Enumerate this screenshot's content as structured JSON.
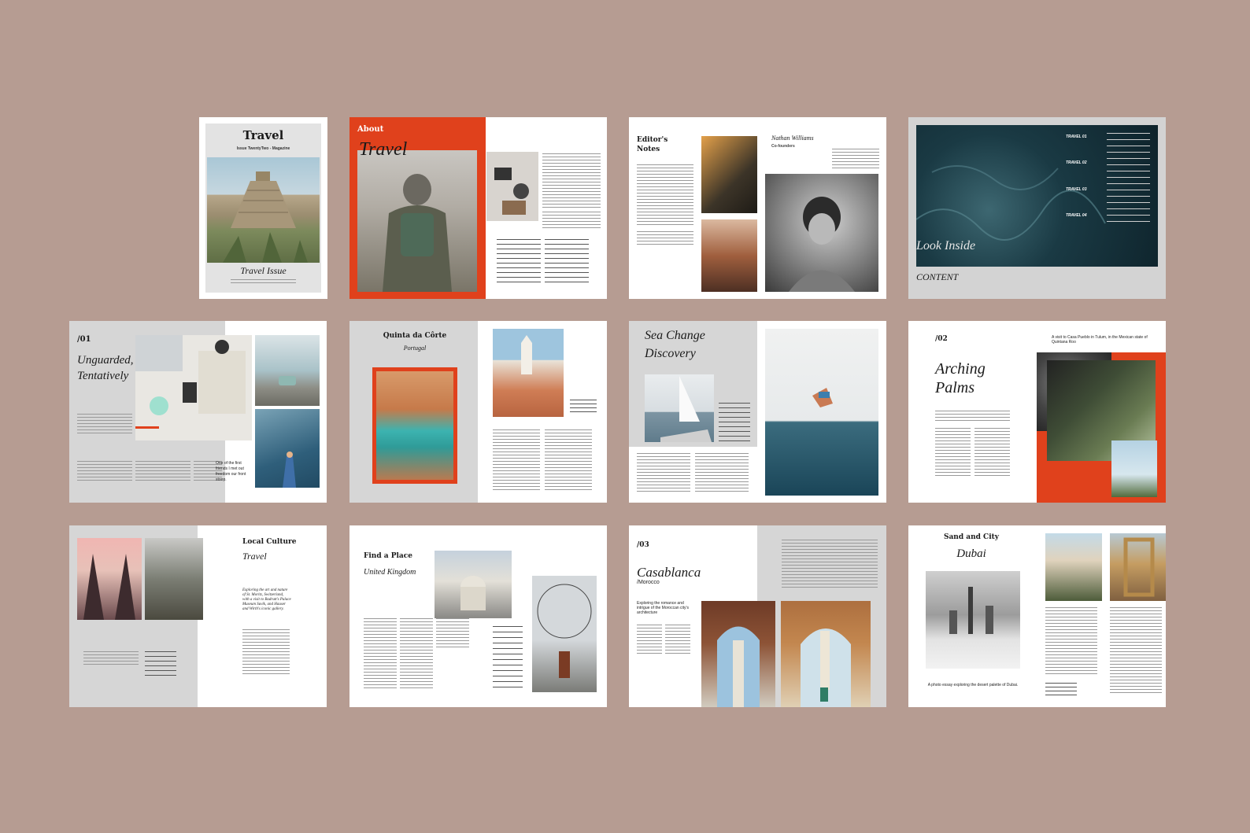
{
  "colors": {
    "background": "#b69c92",
    "accent": "#e0411c",
    "panel_gray": "#d6d6d6"
  },
  "pages": {
    "cover": {
      "title": "Travel",
      "issue": "Issue TwentyTwo - Magazine",
      "script": "Travel Issue"
    },
    "about": {
      "heading": "About",
      "script": "Travel"
    },
    "editors": {
      "title_line1": "Editor's",
      "title_line2": "Notes",
      "author": "Nathan Williams",
      "author_role": "Co-founders"
    },
    "content": {
      "script": "Look Inside",
      "heading": "CONTENT",
      "entries": [
        "TRAVEL 01",
        "TRAVEL 02",
        "TRAVEL 03",
        "TRAVEL 04"
      ]
    },
    "unguarded": {
      "number": "/01",
      "script_line1": "Unguarded,",
      "script_line2": "Tentatively",
      "caption": "One of the first friends I met out freedom our front stoop."
    },
    "quinta": {
      "title": "Quinta da Côrte",
      "subtitle": "Portugal"
    },
    "seachange": {
      "script_line1": "Sea Change",
      "script_line2": "Discovery"
    },
    "arching": {
      "number": "/02",
      "script_line1": "Arching",
      "script_line2": "Palms",
      "note": "A visit to Casa Pueblo in Tulum, in the Mexican state of Quintana Roo"
    },
    "local": {
      "title": "Local Culture",
      "script": "Travel",
      "quote": "Exploring the art and nature of St. Moritz, Switzerland, with a visit to Badrutt's Palace Museum Suvik, and Hauser and Wirth's iconic gallery."
    },
    "findplace": {
      "title": "Find a Place",
      "script": "United Kingdom"
    },
    "casablanca": {
      "number": "/03",
      "script": "Casablanca",
      "sub": "/Morocco",
      "intro": "Exploring the romance and intrigue of the Moroccan city's architecture"
    },
    "sandcity": {
      "title": "Sand and City",
      "script": "Dubai",
      "caption": "A photo essay exploring the desert palette of Dubai."
    }
  }
}
